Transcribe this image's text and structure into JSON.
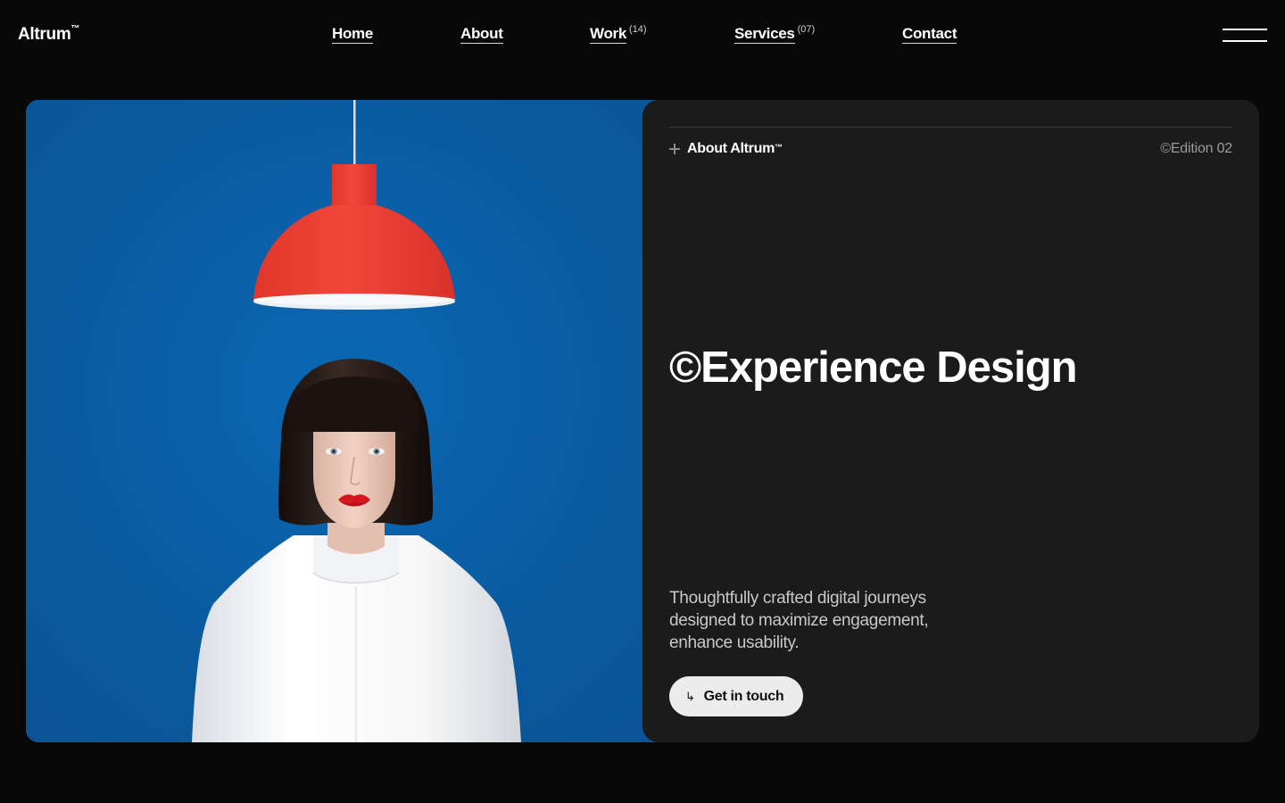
{
  "header": {
    "logo": "Altrum",
    "logo_mark": "™",
    "nav": [
      {
        "label": "Home",
        "count": ""
      },
      {
        "label": "About",
        "count": ""
      },
      {
        "label": "Work",
        "count": "(14)"
      },
      {
        "label": "Services",
        "count": "(07)"
      },
      {
        "label": "Contact",
        "count": ""
      }
    ],
    "menu_icon": "hamburger-icon"
  },
  "hero": {
    "image_description_icon": "portrait-with-red-lamp",
    "colors": {
      "background": "#0a5ea6",
      "lamp": "#e8392d",
      "shirt": "#f4f4f4",
      "hair": "#1e1412",
      "lips": "#d8151c"
    }
  },
  "card": {
    "section_label": "About Altrum",
    "section_mark": "™",
    "edition": "©Edition 02",
    "headline": "©Experience Design",
    "description": "Thoughtfully crafted digital journeys designed to maximize engagement, enhance usability.",
    "cta_arrow": "↳",
    "cta_label": "Get in touch",
    "colors": {
      "card_background": "#1b1b1b",
      "cta_background": "#ececec"
    }
  }
}
